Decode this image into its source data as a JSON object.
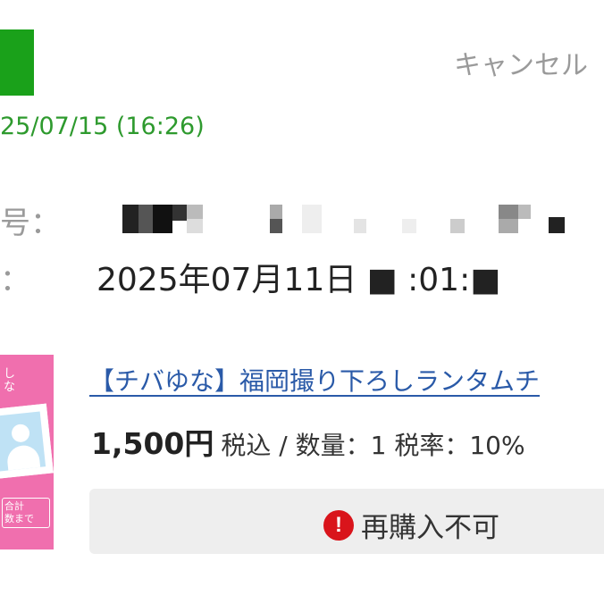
{
  "header": {
    "cancel_label": "キャンセル"
  },
  "order": {
    "datetime": "25/07/15 (16:26)",
    "number_label_fragment": "号：",
    "date_label_fragment": "：",
    "purchase_date": "2025年07月11日 ■ :01:■"
  },
  "item": {
    "title": "【チバゆな】福岡撮り下ろしランタムチ",
    "price": "1,500円",
    "price_detail": "税込 / 数量：1 税率：10%",
    "thumbnail_top_text": "し\nな",
    "thumbnail_bottom_text": "合計\n数まで"
  },
  "repurchase": {
    "label": "再購入不可",
    "icon": "exclamation-circle-icon"
  },
  "colors": {
    "status_green": "#1aa11a",
    "datetime_green": "#2e9a2e",
    "link_blue": "#2a5aa8",
    "warning_red": "#d9141b",
    "thumbnail_pink": "#f06fae"
  }
}
